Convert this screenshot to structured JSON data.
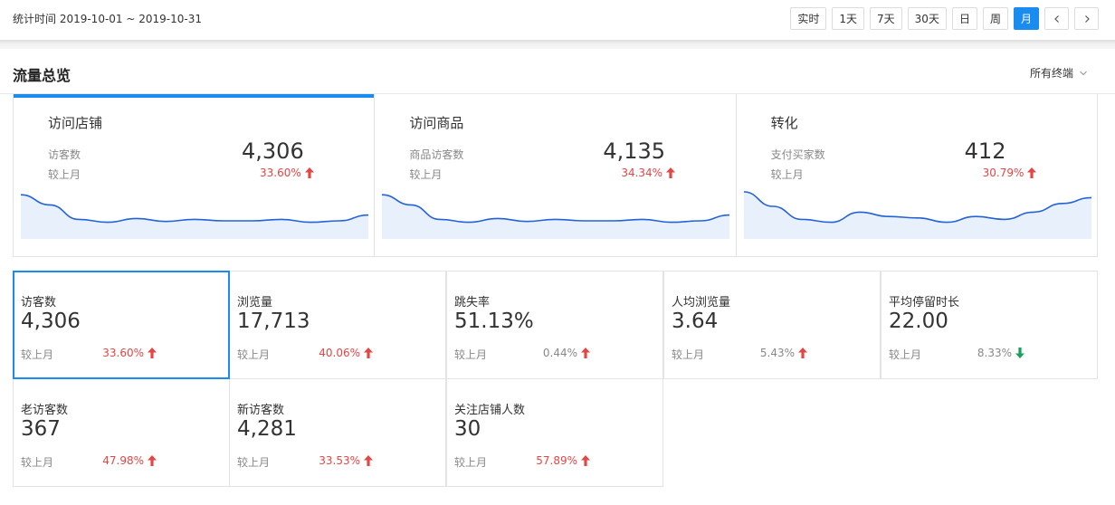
{
  "header": {
    "period": "统计时间 2019-10-01 ~ 2019-10-31",
    "buttons": [
      "实时",
      "1天",
      "7天",
      "30天",
      "日",
      "周",
      "月"
    ],
    "active_button": "月"
  },
  "section": {
    "title": "流量总览",
    "terminal_label": "所有终端"
  },
  "overview": [
    {
      "title": "访问店铺",
      "label": "访客数",
      "compare": "较上月",
      "value": "4,306",
      "pct": "33.60%",
      "trend": "up",
      "spark": [
        0.1,
        0.45,
        0.95,
        1.05,
        0.92,
        1.02,
        0.95,
        1.0,
        1.0,
        0.95,
        1.05,
        1.0,
        0.8
      ]
    },
    {
      "title": "访问商品",
      "label": "商品访客数",
      "compare": "较上月",
      "value": "4,135",
      "pct": "34.34%",
      "trend": "up",
      "spark": [
        0.1,
        0.45,
        0.95,
        1.05,
        0.92,
        1.02,
        0.95,
        1.0,
        1.0,
        0.95,
        1.05,
        1.0,
        0.8
      ]
    },
    {
      "title": "转化",
      "label": "支付买家数",
      "compare": "较上月",
      "value": "412",
      "pct": "30.79%",
      "trend": "up",
      "spark": [
        0.0,
        0.5,
        0.95,
        1.05,
        0.7,
        0.85,
        0.9,
        1.05,
        0.85,
        0.95,
        0.7,
        0.4,
        0.2
      ]
    }
  ],
  "metrics": [
    {
      "name": "访客数",
      "value": "4,306",
      "compare": "较上月",
      "pct": "33.60%",
      "trend": "up",
      "pct_color": "red"
    },
    {
      "name": "浏览量",
      "value": "17,713",
      "compare": "较上月",
      "pct": "40.06%",
      "trend": "up",
      "pct_color": "red"
    },
    {
      "name": "跳失率",
      "value": "51.13%",
      "compare": "较上月",
      "pct": "0.44%",
      "trend": "up",
      "pct_color": "gray"
    },
    {
      "name": "人均浏览量",
      "value": "3.64",
      "compare": "较上月",
      "pct": "5.43%",
      "trend": "up",
      "pct_color": "gray"
    },
    {
      "name": "平均停留时长",
      "value": "22.00",
      "compare": "较上月",
      "pct": "8.33%",
      "trend": "down",
      "pct_color": "gray"
    },
    {
      "name": "老访客数",
      "value": "367",
      "compare": "较上月",
      "pct": "47.98%",
      "trend": "up",
      "pct_color": "red"
    },
    {
      "name": "新访客数",
      "value": "4,281",
      "compare": "较上月",
      "pct": "33.53%",
      "trend": "up",
      "pct_color": "red"
    },
    {
      "name": "关注店铺人数",
      "value": "30",
      "compare": "较上月",
      "pct": "57.89%",
      "trend": "up",
      "pct_color": "red"
    }
  ],
  "colors": {
    "accent": "#1a8cf0",
    "up": "#e64545",
    "down": "#19a15f",
    "muted": "#888888",
    "spark_fill": "#e8f0fb",
    "spark_line": "#2463d6"
  },
  "icons": {
    "prev": "chevron-left-icon",
    "next": "chevron-right-icon",
    "dropdown": "chevron-down-icon",
    "up": "arrow-up-icon",
    "down": "arrow-down-icon"
  }
}
